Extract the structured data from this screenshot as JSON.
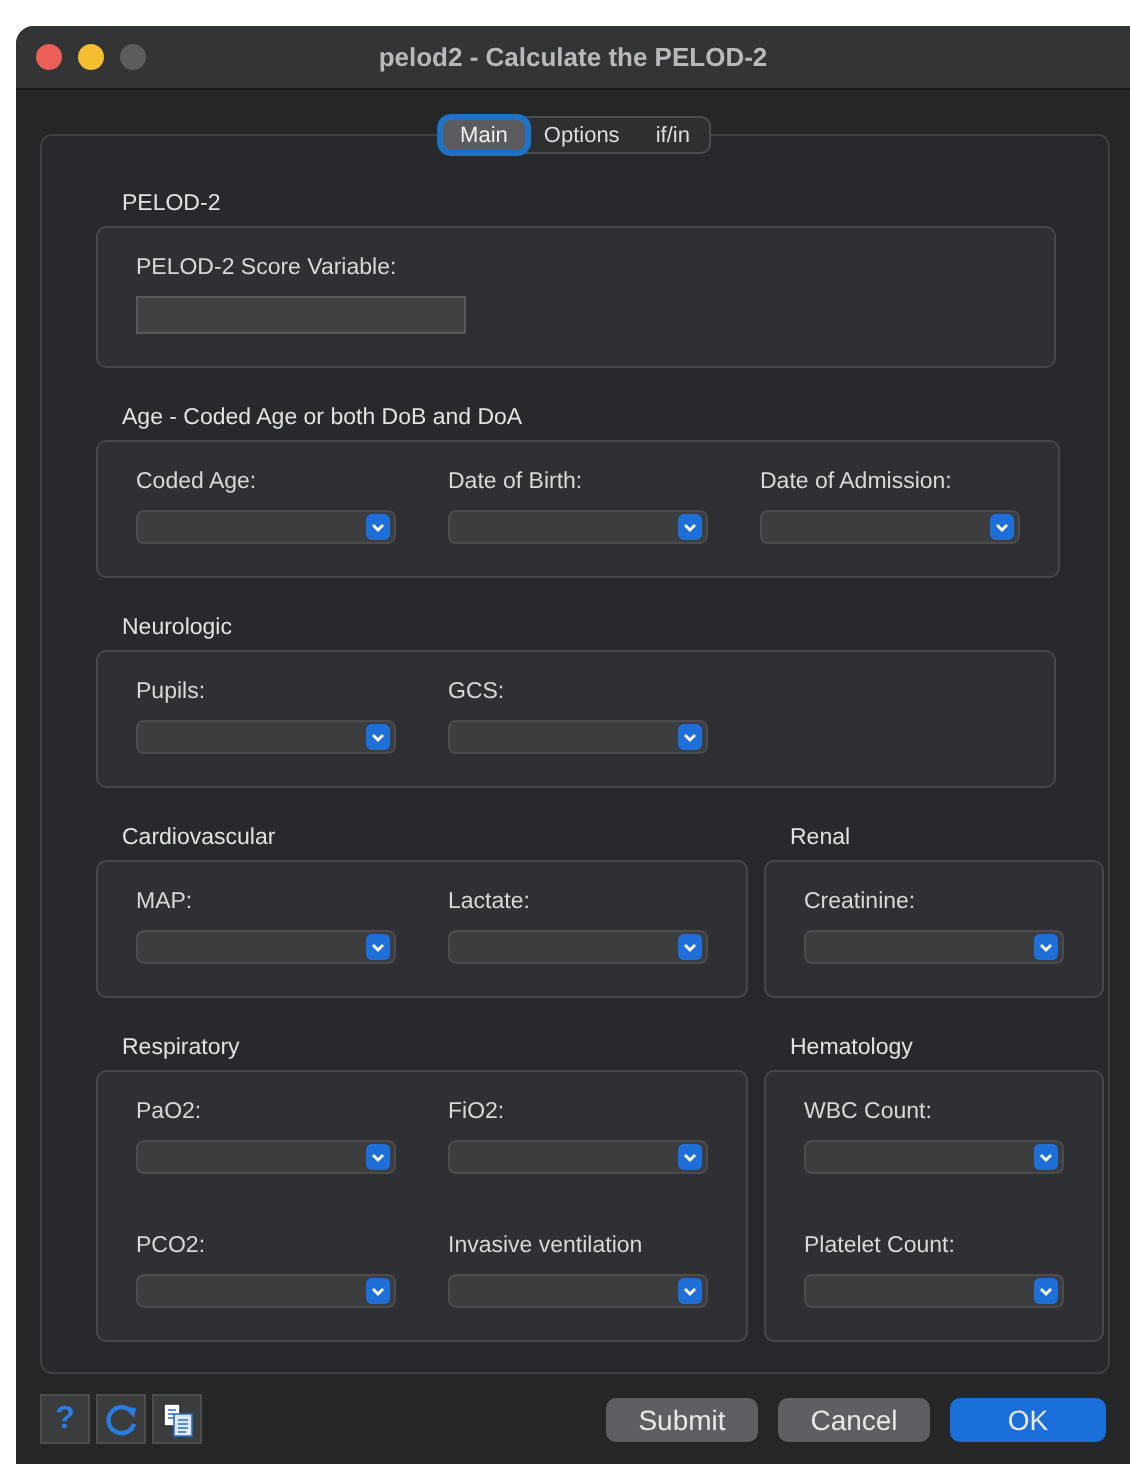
{
  "window": {
    "title": "pelod2 - Calculate the PELOD-2"
  },
  "tabs": [
    {
      "label": "Main",
      "selected": true
    },
    {
      "label": "Options",
      "selected": false
    },
    {
      "label": "if/in",
      "selected": false
    }
  ],
  "sections": [
    [
      {
        "title": "PELOD-2",
        "rows": [
          [
            {
              "label": "PELOD-2 Score Variable:",
              "kind": "text"
            }
          ]
        ]
      }
    ],
    [
      {
        "title": "Age - Coded Age or both DoB and DoA",
        "rows": [
          [
            {
              "label": "Coded Age:",
              "kind": "dropdown"
            },
            {
              "label": "Date of Birth:",
              "kind": "dropdown"
            },
            {
              "label": "Date of Admission:",
              "kind": "dropdown"
            }
          ]
        ]
      }
    ],
    [
      {
        "title": "Neurologic",
        "rows": [
          [
            {
              "label": "Pupils:",
              "kind": "dropdown"
            },
            {
              "label": "GCS:",
              "kind": "dropdown"
            }
          ]
        ]
      }
    ],
    [
      {
        "title": "Cardiovascular",
        "rows": [
          [
            {
              "label": "MAP:",
              "kind": "dropdown"
            },
            {
              "label": "Lactate:",
              "kind": "dropdown"
            }
          ]
        ]
      },
      {
        "title": "Renal",
        "rows": [
          [
            {
              "label": "Creatinine:",
              "kind": "dropdown"
            }
          ]
        ]
      }
    ],
    [
      {
        "title": "Respiratory",
        "rows": [
          [
            {
              "label": "PaO2:",
              "kind": "dropdown"
            },
            {
              "label": "FiO2:",
              "kind": "dropdown"
            }
          ],
          [
            {
              "label": "PCO2:",
              "kind": "dropdown"
            },
            {
              "label": "Invasive ventilation",
              "kind": "dropdown"
            }
          ]
        ]
      },
      {
        "title": "Hematology",
        "rows": [
          [
            {
              "label": "WBC Count:",
              "kind": "dropdown"
            }
          ],
          [
            {
              "label": "Platelet Count:",
              "kind": "dropdown"
            }
          ]
        ]
      }
    ]
  ],
  "tool_buttons": [
    {
      "kind": "help",
      "label": "?"
    },
    {
      "kind": "reset"
    },
    {
      "kind": "copy"
    }
  ],
  "buttons": [
    {
      "label": "Submit",
      "kind": "plain"
    },
    {
      "label": "Cancel",
      "kind": "plain"
    },
    {
      "label": "OK",
      "kind": "default"
    }
  ]
}
